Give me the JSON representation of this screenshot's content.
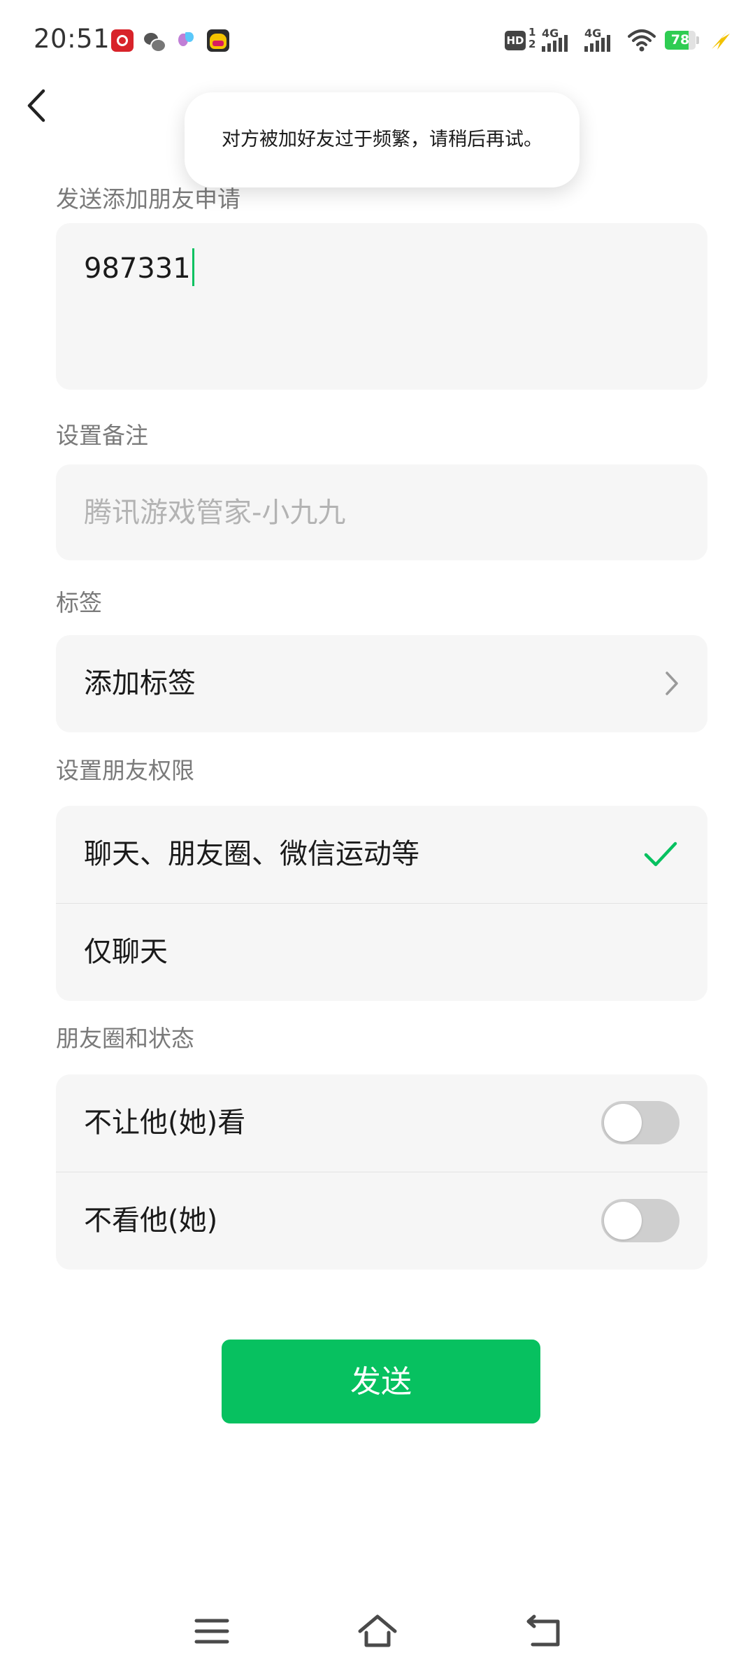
{
  "status_bar": {
    "time": "20:51",
    "notification_icons": [
      "netease-music-icon",
      "wechat-icon",
      "bird-app-icon",
      "game-app-icon"
    ],
    "hd_badge": "HD",
    "hd_sub_top": "1",
    "hd_sub_bottom": "2",
    "network_1": "4G",
    "network_2": "4G",
    "battery_level": "78",
    "battery_fraction": 0.78,
    "colors": {
      "battery_fill": "#2fcc52",
      "charging_bolt": "#f2c200"
    }
  },
  "toast": {
    "message": "对方被加好友过于频繁，请稍后再试。"
  },
  "request_section": {
    "label": "发送添加朋友申请",
    "message_value": "987331"
  },
  "remark_section": {
    "label": "设置备注",
    "placeholder": "腾讯游戏管家-小九九"
  },
  "tag_section": {
    "label": "标签",
    "add_tag": "添加标签"
  },
  "permission_section": {
    "label": "设置朋友权限",
    "options": [
      {
        "label": "聊天、朋友圈、微信运动等",
        "selected": true
      },
      {
        "label": "仅聊天",
        "selected": false
      }
    ]
  },
  "moments_section": {
    "label": "朋友圈和状态",
    "toggles": [
      {
        "label": "不让他(她)看",
        "on": false
      },
      {
        "label": "不看他(她)",
        "on": false
      }
    ]
  },
  "send_button": {
    "label": "发送"
  },
  "theme": {
    "accent": "#07c160",
    "card_bg": "#f6f6f6",
    "label_color": "#7a7a7a"
  },
  "system_nav": {
    "icons": [
      "menu-icon",
      "home-icon",
      "back-icon"
    ]
  }
}
